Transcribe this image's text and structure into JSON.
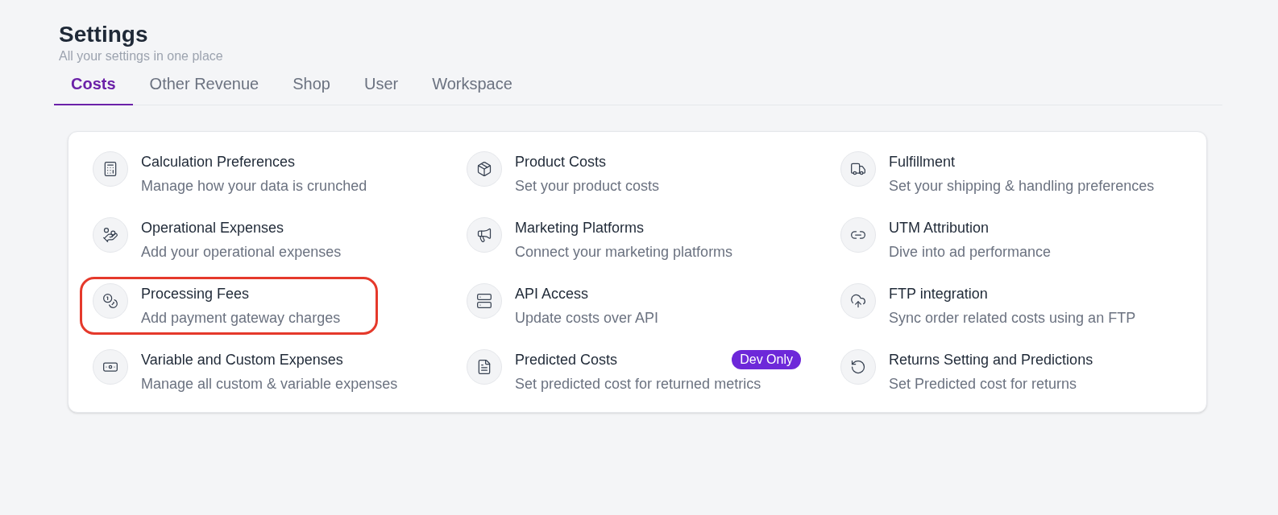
{
  "header": {
    "title": "Settings",
    "subtitle": "All your settings in one place"
  },
  "tabs": [
    {
      "label": "Costs",
      "selected": true
    },
    {
      "label": "Other Revenue",
      "selected": false
    },
    {
      "label": "Shop",
      "selected": false
    },
    {
      "label": "User",
      "selected": false
    },
    {
      "label": "Workspace",
      "selected": false
    }
  ],
  "items": [
    {
      "title": "Calculation Preferences",
      "description": "Manage how your data is crunched",
      "highlighted": false
    },
    {
      "title": "Product Costs",
      "description": "Set your product costs",
      "highlighted": false
    },
    {
      "title": "Fulfillment",
      "description": "Set your shipping & handling preferences",
      "highlighted": false
    },
    {
      "title": "Operational Expenses",
      "description": "Add your operational expenses",
      "highlighted": false
    },
    {
      "title": "Marketing Platforms",
      "description": "Connect your marketing platforms",
      "highlighted": false
    },
    {
      "title": "UTM Attribution",
      "description": "Dive into ad performance",
      "highlighted": false
    },
    {
      "title": "Processing Fees",
      "description": "Add payment gateway charges",
      "highlighted": true
    },
    {
      "title": "API Access",
      "description": "Update costs over API",
      "highlighted": false
    },
    {
      "title": "FTP integration",
      "description": "Sync order related costs using an FTP",
      "highlighted": false
    },
    {
      "title": "Variable and Custom Expenses",
      "description": "Manage all custom & variable expenses",
      "highlighted": false
    },
    {
      "title": "Predicted Costs",
      "description": "Set predicted cost for returned metrics",
      "badge": "Dev Only",
      "highlighted": false
    },
    {
      "title": "Returns Setting and Predictions",
      "description": "Set Predicted cost for returns",
      "highlighted": false
    }
  ]
}
